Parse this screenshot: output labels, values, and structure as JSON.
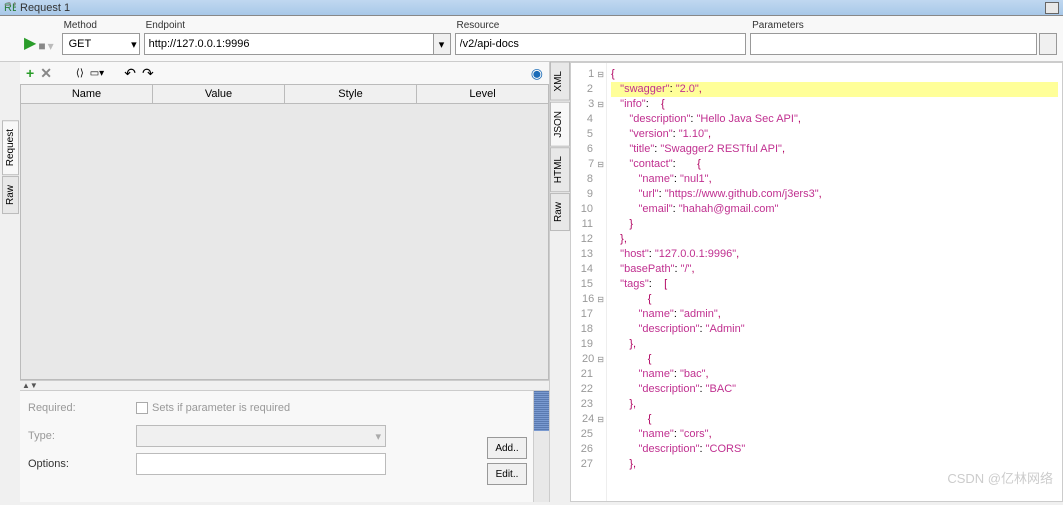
{
  "title": "Request 1",
  "toolbar": {
    "method_label": "Method",
    "method_value": "GET",
    "endpoint_label": "Endpoint",
    "endpoint_value": "http://127.0.0.1:9996",
    "resource_label": "Resource",
    "resource_value": "/v2/api-docs",
    "parameters_label": "Parameters",
    "parameters_value": ""
  },
  "left_tabs": {
    "request": "Request",
    "raw": "Raw"
  },
  "right_tabs": {
    "xml": "XML",
    "json": "JSON",
    "html": "HTML",
    "raw": "Raw"
  },
  "table": {
    "cols": [
      "Name",
      "Value",
      "Style",
      "Level"
    ]
  },
  "props": {
    "required_label": "Required:",
    "required_text": "Sets if parameter is required",
    "type_label": "Type:",
    "options_label": "Options:",
    "add": "Add..",
    "edit": "Edit.."
  },
  "code": {
    "lines": [
      {
        "n": 1,
        "fold": "⊟",
        "txt": "{"
      },
      {
        "n": 2,
        "hl": true,
        "txt": "   \"swagger\": \"2.0\","
      },
      {
        "n": 3,
        "fold": "⊟",
        "txt": "   \"info\":    {"
      },
      {
        "n": 4,
        "txt": "      \"description\": \"Hello Java Sec API\","
      },
      {
        "n": 5,
        "txt": "      \"version\": \"1.10\","
      },
      {
        "n": 6,
        "txt": "      \"title\": \"Swagger2 RESTful API\","
      },
      {
        "n": 7,
        "fold": "⊟",
        "txt": "      \"contact\":       {"
      },
      {
        "n": 8,
        "txt": "         \"name\": \"nul1\","
      },
      {
        "n": 9,
        "txt": "         \"url\": \"https://www.github.com/j3ers3\","
      },
      {
        "n": 10,
        "txt": "         \"email\": \"hahah@gmail.com\""
      },
      {
        "n": 11,
        "txt": "      }"
      },
      {
        "n": 12,
        "txt": "   },"
      },
      {
        "n": 13,
        "txt": "   \"host\": \"127.0.0.1:9996\","
      },
      {
        "n": 14,
        "txt": "   \"basePath\": \"/\","
      },
      {
        "n": 15,
        "txt": "   \"tags\":    ["
      },
      {
        "n": 16,
        "fold": "⊟",
        "txt": "            {"
      },
      {
        "n": 17,
        "txt": "         \"name\": \"admin\","
      },
      {
        "n": 18,
        "txt": "         \"description\": \"Admin\""
      },
      {
        "n": 19,
        "txt": "      },"
      },
      {
        "n": 20,
        "fold": "⊟",
        "txt": "            {"
      },
      {
        "n": 21,
        "txt": "         \"name\": \"bac\","
      },
      {
        "n": 22,
        "txt": "         \"description\": \"BAC\""
      },
      {
        "n": 23,
        "txt": "      },"
      },
      {
        "n": 24,
        "fold": "⊟",
        "txt": "            {"
      },
      {
        "n": 25,
        "txt": "         \"name\": \"cors\","
      },
      {
        "n": 26,
        "txt": "         \"description\": \"CORS\""
      },
      {
        "n": 27,
        "txt": "      },"
      }
    ]
  },
  "watermark": "CSDN @亿林网络"
}
